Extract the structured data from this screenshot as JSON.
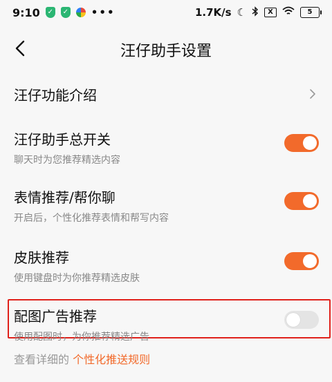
{
  "status_bar": {
    "time": "9:10",
    "left_icons": [
      "shield-icon",
      "shield-icon",
      "pinwheel-icon",
      "more-dots-icon"
    ],
    "net_speed": "1.7K/s",
    "sim_label": "X",
    "battery_level": "5",
    "right_icons": [
      "moon-icon",
      "bluetooth-icon",
      "no-sim-icon",
      "wifi-icon",
      "battery-icon"
    ]
  },
  "nav": {
    "title": "汪仔助手设置",
    "back_icon": "chevron-left-icon"
  },
  "settings": {
    "intro": {
      "title": "汪仔功能介绍",
      "icon": "chevron-right-icon"
    },
    "items": [
      {
        "title": "汪仔助手总开关",
        "subtitle": "聊天时为您推荐精选内容",
        "enabled": true
      },
      {
        "title": "表情推荐/帮你聊",
        "subtitle": "开启后，个性化推荐表情和帮写内容",
        "enabled": true
      },
      {
        "title": "皮肤推荐",
        "subtitle": "使用键盘时为你推荐精选皮肤",
        "enabled": true
      },
      {
        "title": "配图广告推荐",
        "subtitle": "使用配图时，为你推荐精选广告",
        "enabled": false
      }
    ]
  },
  "footer": {
    "prefix": "查看详细的",
    "link": "个性化推送规则"
  },
  "colors": {
    "accent": "#f26a2b",
    "highlight": "#e0201a",
    "background": "#f7f7f7",
    "toggle_off": "#e4e4e4"
  }
}
